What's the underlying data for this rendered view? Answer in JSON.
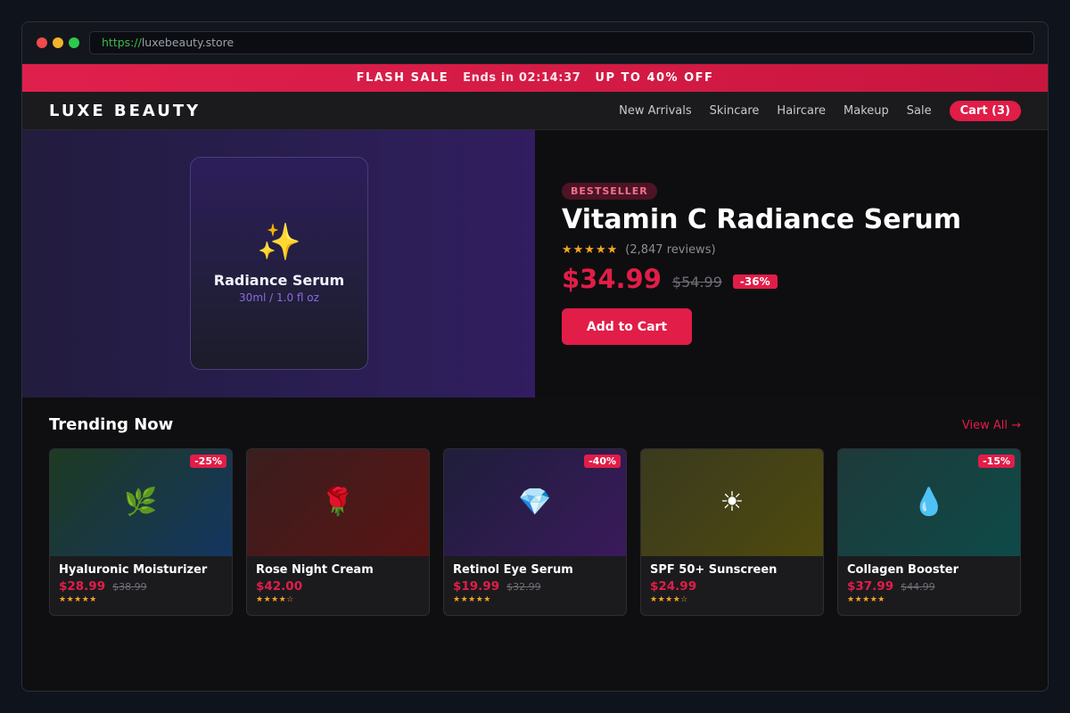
{
  "browser": {
    "url_scheme": "https://",
    "url_host": "luxebeauty.store"
  },
  "flash_bar": {
    "label": "FLASH SALE",
    "ends": "Ends in 02:14:37",
    "offer": "UP TO 40% OFF"
  },
  "nav": {
    "brand": "LUXE BEAUTY",
    "links": [
      "New Arrivals",
      "Skincare",
      "Haircare",
      "Makeup",
      "Sale"
    ],
    "cart": "Cart (3)"
  },
  "hero": {
    "card": {
      "icon": "sparkles-icon",
      "icon_glyph": "✨",
      "name": "Radiance Serum",
      "size": "30ml / 1.0 fl oz"
    },
    "badge": "BESTSELLER",
    "title": "Vitamin C Radiance Serum",
    "stars": "★★★★★",
    "rating": 5,
    "reviews": "(2,847 reviews)",
    "price": "$34.99",
    "old_price": "$54.99",
    "discount": "-36%",
    "add_to_cart": "Add to Cart"
  },
  "trending": {
    "title": "Trending Now",
    "view_all": "View All →",
    "products": [
      {
        "name": "Hyaluronic Moisturizer",
        "price": "$28.99",
        "old_price": "$38.99",
        "badge": "-25%",
        "stars": "★★★★★",
        "rating": 5,
        "icon": "herb-icon",
        "icon_glyph": "🌿",
        "bg_from": "#1e3a22",
        "bg_to": "#143660"
      },
      {
        "name": "Rose Night Cream",
        "price": "$42.00",
        "old_price": "",
        "badge": "",
        "stars": "★★★★☆",
        "rating": 4,
        "icon": "rose-icon",
        "icon_glyph": "🌹",
        "bg_from": "#3a1e1e",
        "bg_to": "#5a1414"
      },
      {
        "name": "Retinol Eye Serum",
        "price": "$19.99",
        "old_price": "$32.99",
        "badge": "-40%",
        "stars": "★★★★★",
        "rating": 5,
        "icon": "gem-icon",
        "icon_glyph": "💎",
        "bg_from": "#1e1e3a",
        "bg_to": "#3a1a5c"
      },
      {
        "name": "SPF 50+ Sunscreen",
        "price": "$24.99",
        "old_price": "",
        "badge": "",
        "stars": "★★★★☆",
        "rating": 4,
        "icon": "sun-icon",
        "icon_glyph": "☀",
        "bg_from": "#3a3a1e",
        "bg_to": "#4e4a0e"
      },
      {
        "name": "Collagen Booster",
        "price": "$37.99",
        "old_price": "$44.99",
        "badge": "-15%",
        "stars": "★★★★★",
        "rating": 5,
        "icon": "droplet-icon",
        "icon_glyph": "💧",
        "bg_from": "#1e3a3a",
        "bg_to": "#0e4a48"
      }
    ]
  },
  "colors": {
    "accent": "#e11d48",
    "star": "#f5a623",
    "hero_purple": "#311d60"
  }
}
